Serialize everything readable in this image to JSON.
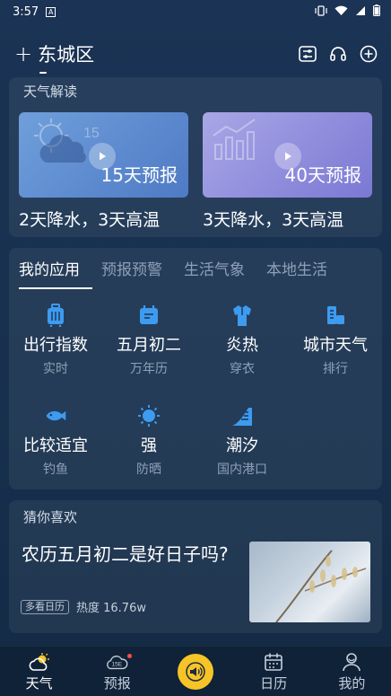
{
  "status_bar": {
    "time": "3:57",
    "notif_icon": "A"
  },
  "header": {
    "add_label": "+",
    "city": "东城区"
  },
  "interpretation": {
    "title": "天气解读",
    "items": [
      {
        "label": "15天预报",
        "caption": "2天降水，3天高温",
        "icon": "cloud-sun-icon",
        "badge": "15"
      },
      {
        "label": "40天预报",
        "caption": "3天降水，3天高温",
        "icon": "bar-chart-icon"
      }
    ]
  },
  "apps": {
    "tabs": [
      "我的应用",
      "预报预警",
      "生活气象",
      "本地生活"
    ],
    "active_tab": 0,
    "items": [
      {
        "title": "出行指数",
        "sub": "实时",
        "icon": "luggage-icon"
      },
      {
        "title": "五月初二",
        "sub": "万年历",
        "icon": "calendar-icon"
      },
      {
        "title": "炎热",
        "sub": "穿衣",
        "icon": "shirt-icon"
      },
      {
        "title": "城市天气",
        "sub": "排行",
        "icon": "ranking-icon"
      },
      {
        "title": "比较适宜",
        "sub": "钓鱼",
        "icon": "fish-icon"
      },
      {
        "title": "强",
        "sub": "防晒",
        "icon": "sun-icon"
      },
      {
        "title": "潮汐",
        "sub": "国内港口",
        "icon": "tide-icon"
      }
    ]
  },
  "guess": {
    "title": "猜你喜欢",
    "article_title": "农历五月初二是好日子吗?",
    "tag": "多看日历",
    "heat": "热度 16.76w"
  },
  "bottom_nav": [
    {
      "label": "天气",
      "icon": "weather-icon",
      "active": true
    },
    {
      "label": "预报",
      "icon": "forecast-15-icon",
      "badge_text": "15E",
      "has_dot": true
    },
    {
      "label": "",
      "icon": "speaker-icon"
    },
    {
      "label": "日历",
      "icon": "calendar-icon"
    },
    {
      "label": "我的",
      "icon": "user-icon"
    }
  ],
  "colors": {
    "accent_yellow": "#f7c428",
    "muted_text": "#8ea0b7",
    "background": "#1b3354"
  }
}
